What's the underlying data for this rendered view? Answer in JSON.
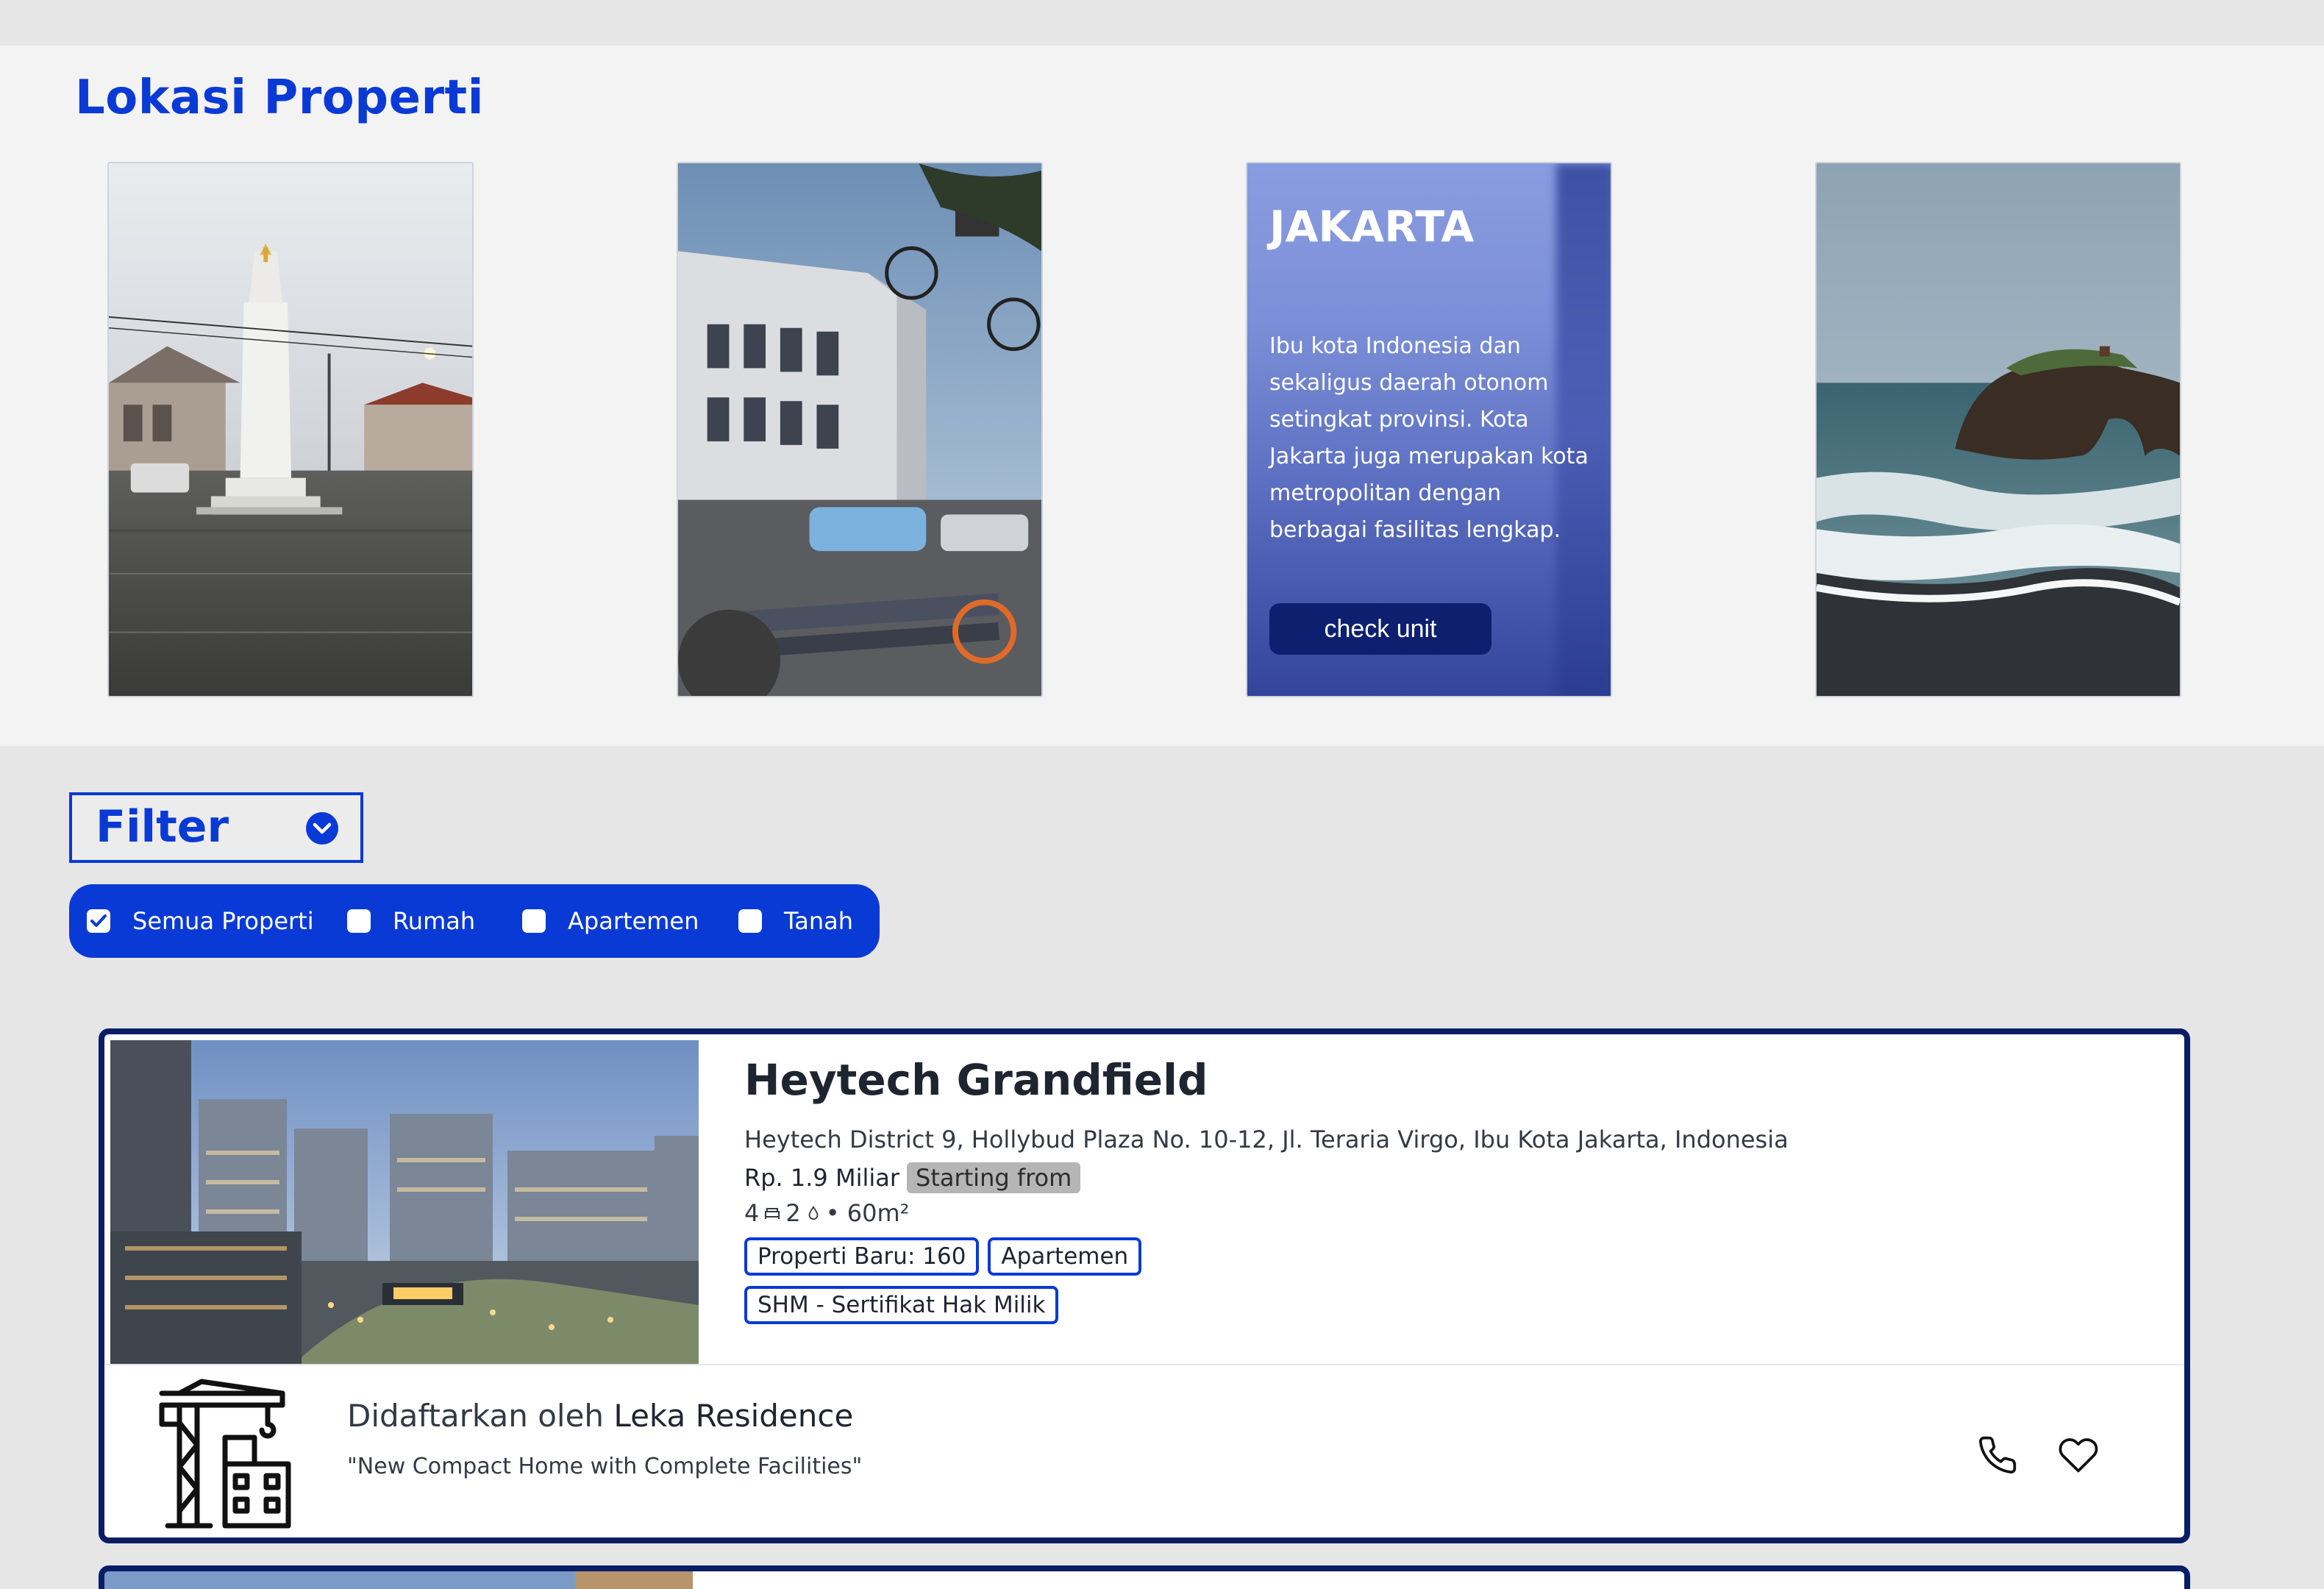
{
  "lokasi": {
    "title": "Lokasi Properti",
    "cards": [
      {
        "name": "yogyakarta-photo"
      },
      {
        "name": "bandung-photo"
      },
      {
        "name": "jakarta",
        "title": "JAKARTA",
        "description": "Ibu kota Indonesia dan sekaligus daerah otonom setingkat provinsi. Kota Jakarta juga merupakan kota metropolitan dengan berbagai fasilitas lengkap.",
        "button": "check unit"
      },
      {
        "name": "bali-photo"
      }
    ]
  },
  "filter": {
    "label": "Filter",
    "icon": "chevron-down-icon",
    "options": [
      {
        "label": "Semua Properti",
        "checked": true
      },
      {
        "label": "Rumah",
        "checked": false
      },
      {
        "label": "Apartemen",
        "checked": false
      },
      {
        "label": "Tanah",
        "checked": false
      }
    ]
  },
  "listing": {
    "name": "Heytech Grandfield",
    "address": "Heytech District 9, Hollybud Plaza No. 10-12, Jl. Teraria Virgo, Ibu Kota Jakarta, Indonesia",
    "price": "Rp. 1.9 Miliar",
    "price_note": "Starting from",
    "bedrooms": "4",
    "bathrooms": "2",
    "area": "• 60m²",
    "tags": [
      "Properti Baru: 160",
      "Apartemen",
      "SHM - Sertifikat Hak Milik"
    ],
    "listed_prefix": "Didaftarkan oleh",
    "developer": "Leka Residence",
    "tagline": "\"New Compact Home with Complete Facilities\""
  },
  "colors": {
    "brand_blue": "#0a3ad6",
    "navy": "#0a1e66",
    "page_bg": "#e6e6e6",
    "section_bg": "#f3f3f3"
  }
}
